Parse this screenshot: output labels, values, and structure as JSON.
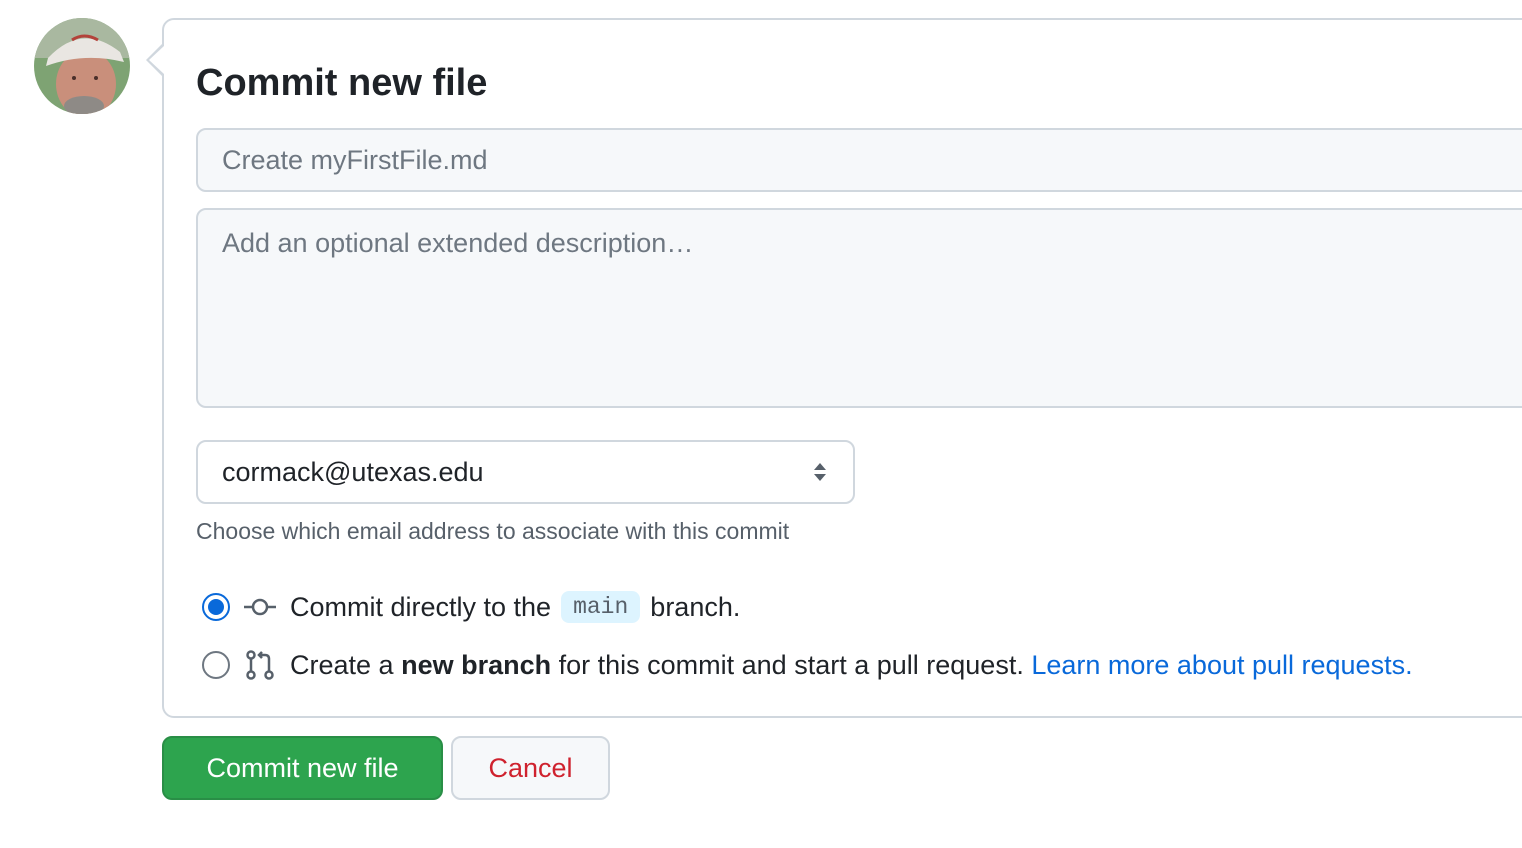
{
  "user": {
    "avatar_alt": "User avatar"
  },
  "commit_form": {
    "title": "Commit new file",
    "summary_placeholder": "Create myFirstFile.md",
    "summary_value": "",
    "description_placeholder": "Add an optional extended description…",
    "description_value": "",
    "email_selected": "cormack@utexas.edu",
    "email_note": "Choose which email address to associate with this commit",
    "options": {
      "direct": {
        "selected": true,
        "icon": "git-commit-icon",
        "text_before": "Commit directly to the",
        "branch": "main",
        "text_after": "branch."
      },
      "new_branch": {
        "selected": false,
        "icon": "git-pull-request-icon",
        "text_before": "Create a",
        "bold": "new branch",
        "text_after": "for this commit and start a pull request.",
        "link": "Learn more about pull requests."
      }
    }
  },
  "buttons": {
    "commit": "Commit new file",
    "cancel": "Cancel"
  },
  "colors": {
    "primary_green": "#2da44e",
    "link_blue": "#0969da",
    "cancel_red": "#cf222e",
    "border": "#d0d7de",
    "input_bg": "#f6f8fa"
  }
}
